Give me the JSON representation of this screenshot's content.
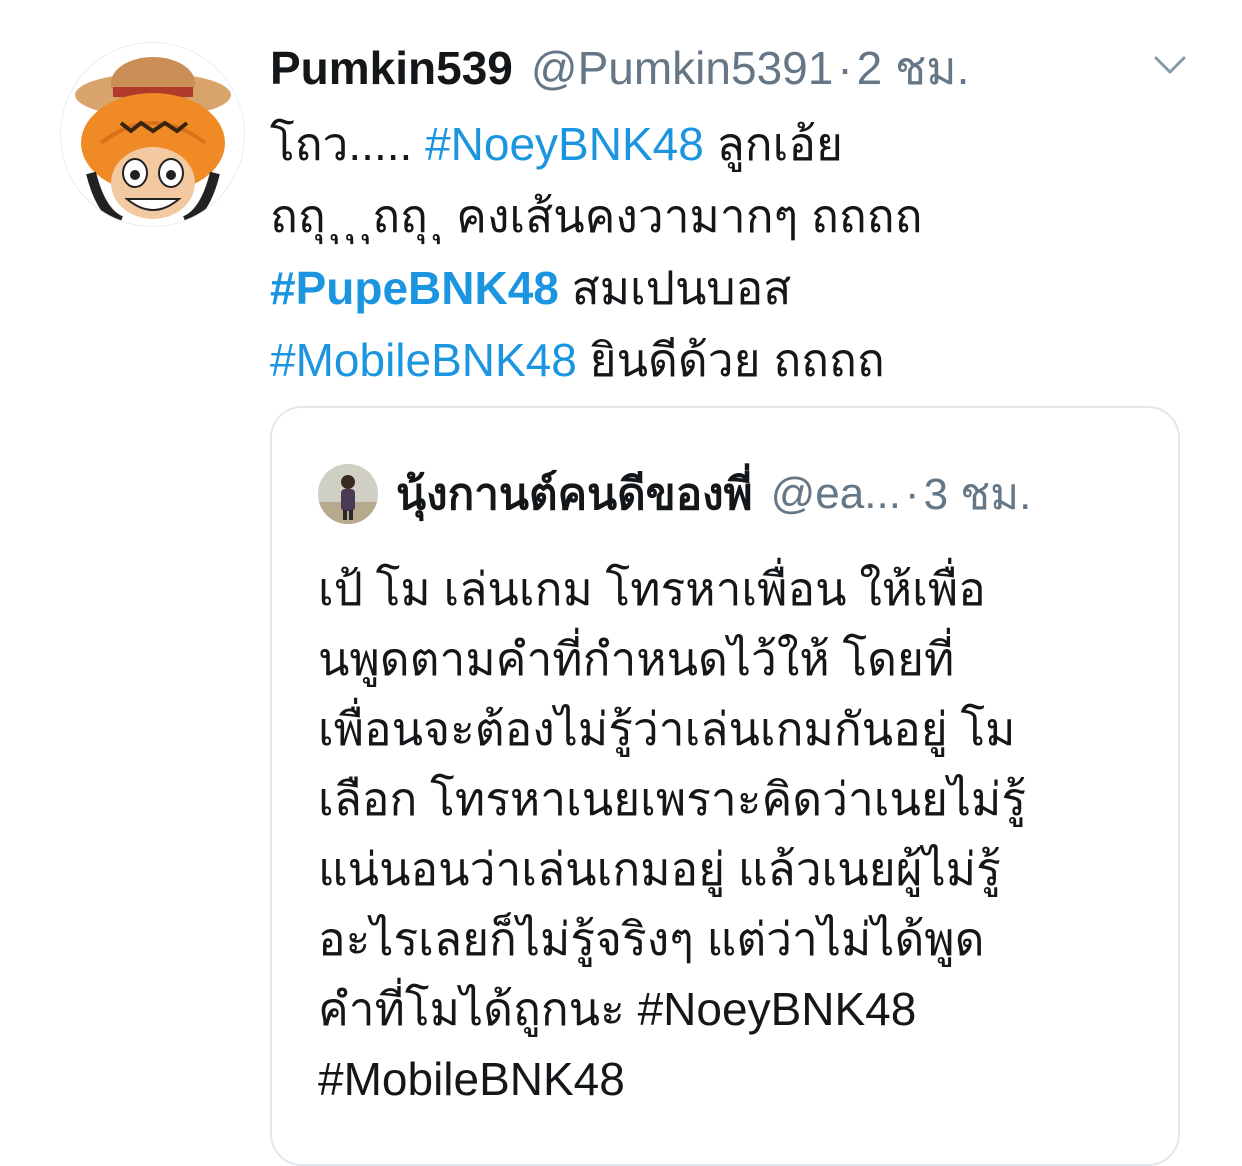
{
  "tweet": {
    "author_name": "Pumkin539",
    "author_handle": "@Pumkin5391",
    "separator": "·",
    "time": "2 ชม.",
    "avatar_icon": "pumpkin-hat-character-avatar",
    "text_lines": [
      [
        {
          "text": "โถว..... ",
          "type": "text"
        },
        {
          "text": "#NoeyBNK48",
          "type": "hashtag"
        },
        {
          "text": " ลูกเอ้ย",
          "type": "text"
        }
      ],
      [
        {
          "text": "ถถุ ุ ุ ุถถุ ุ คงเส้นคงวามากๆ ถถถถ",
          "type": "text"
        }
      ],
      [
        {
          "text": "#PupeBNK48",
          "type": "hashtag_bold"
        },
        {
          "text": "  สมเปนบอส",
          "type": "text"
        }
      ],
      [
        {
          "text": "#MobileBNK48",
          "type": "hashtag"
        },
        {
          "text": "  ยินดีด้วย ถถถถ",
          "type": "text"
        }
      ]
    ]
  },
  "quoted_tweet": {
    "author_name": "นุ้งกานต์คนดีของพี่",
    "author_handle": "@ea...",
    "separator": "·",
    "time": "3 ชม.",
    "avatar_icon": "person-photo-avatar",
    "text_lines": [
      "เป้ โม เล่นเกม โทรหาเพื่อน ให้เพื่อ",
      "นพูดตามคำที่กำหนดไว้ให้ โดยที่",
      "เพื่อนจะต้องไม่รู้ว่าเล่นเกมกันอยู่ โม",
      "เลือก โทรหาเนยเพราะคิดว่าเนยไม่รู้",
      "แน่นอนว่าเล่นเกมอยู่ แล้วเนยผู้ไม่รู้",
      "อะไรเลยก็ไม่รู้จริงๆ แต่ว่าไม่ได้พูด",
      "คำที่โมได้ถูกนะ #NoeyBNK48",
      "#MobileBNK48"
    ]
  },
  "colors": {
    "link": "#1b95e0",
    "secondary_text": "#657786",
    "primary_text": "#14171a",
    "border": "#e1e8ed"
  },
  "icons": {
    "menu": "chevron-down-icon"
  }
}
